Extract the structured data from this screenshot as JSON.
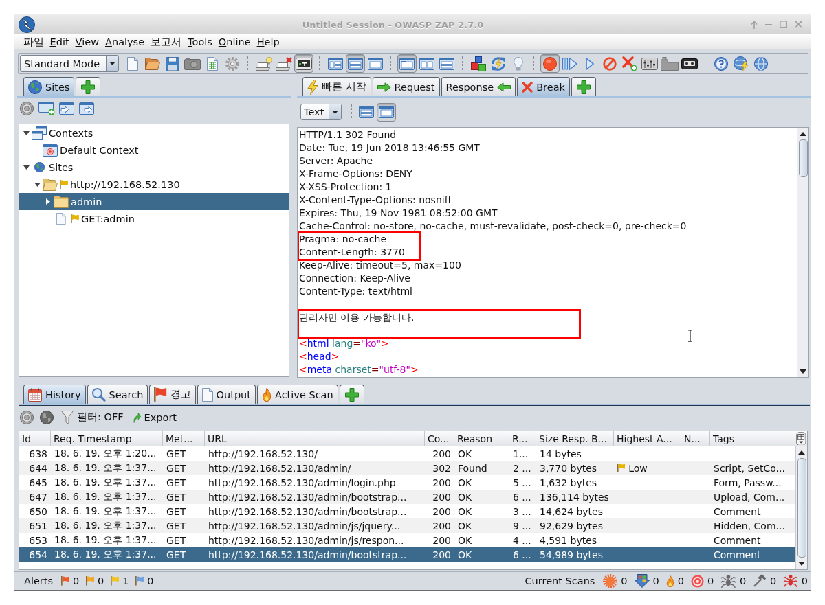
{
  "window": {
    "title": "Untitled Session - OWASP ZAP 2.7.0"
  },
  "menu": [
    {
      "label": "파일",
      "mnemonic": false
    },
    {
      "label": "Edit",
      "mnemonic": true
    },
    {
      "label": "View",
      "mnemonic": true
    },
    {
      "label": "Analyse",
      "mnemonic": true
    },
    {
      "label": "보고서",
      "mnemonic": false
    },
    {
      "label": "Tools",
      "mnemonic": true
    },
    {
      "label": "Online",
      "mnemonic": true
    },
    {
      "label": "Help",
      "mnemonic": true
    }
  ],
  "toolbar": {
    "mode": "Standard Mode",
    "groups": [
      {
        "buttons": [
          {
            "pressed": false
          },
          {
            "pressed": false
          },
          {
            "pressed": false
          },
          {
            "pressed": false
          },
          {
            "pressed": false
          },
          {
            "pressed": false
          }
        ]
      },
      {
        "buttons": [
          {
            "pressed": false
          },
          {
            "pressed": false
          },
          {
            "pressed": true
          }
        ]
      },
      {
        "buttons": [
          {
            "pressed": false
          },
          {
            "pressed": true
          },
          {
            "pressed": false
          }
        ]
      },
      {
        "buttons": [
          {
            "pressed": true
          },
          {
            "pressed": false
          },
          {
            "pressed": false
          }
        ]
      },
      {
        "buttons": [
          {
            "pressed": false
          },
          {
            "pressed": false
          },
          {
            "pressed": false
          }
        ]
      },
      {
        "buttons": [
          {
            "pressed": true
          },
          {
            "pressed": false
          },
          {
            "pressed": false
          },
          {
            "pressed": false
          },
          {
            "pressed": false
          },
          {
            "pressed": false
          },
          {
            "pressed": false
          },
          {
            "pressed": false
          }
        ]
      },
      {
        "buttons": [
          {
            "pressed": false
          },
          {
            "pressed": false
          },
          {
            "pressed": false
          }
        ]
      }
    ]
  },
  "sites_panel": {
    "tabs": [
      {
        "label": "Sites",
        "selected": true
      }
    ],
    "tree": [
      {
        "label": "Contexts",
        "kind": "contexts",
        "expanded": true,
        "selected": false,
        "children": [
          {
            "label": "Default Context",
            "kind": "context",
            "selected": false
          }
        ]
      },
      {
        "label": "Sites",
        "kind": "sites",
        "expanded": true,
        "selected": false,
        "children": [
          {
            "label": "http://192.168.52.130",
            "kind": "site",
            "expanded": true,
            "flagged": true,
            "selected": false,
            "children": [
              {
                "label": "admin",
                "kind": "folder",
                "expanded": false,
                "flagged": false,
                "selected": true
              },
              {
                "label": "GET:admin",
                "kind": "page",
                "flagged": true,
                "selected": false
              }
            ]
          }
        ]
      }
    ]
  },
  "message_panel": {
    "tabs": [
      {
        "label": "빠른 시작",
        "selected": false
      },
      {
        "label": "Request",
        "selected": false
      },
      {
        "label": "Response",
        "selected": false
      },
      {
        "label": "Break",
        "selected": true
      }
    ],
    "format": "Text",
    "view_buttons": [
      {
        "selected": false
      },
      {
        "selected": true
      }
    ],
    "headers": [
      {
        "highlight": false,
        "lines": [
          "HTTP/1.1 302 Found",
          "Date: Tue, 19 Jun 2018 13:46:55 GMT",
          "Server: Apache",
          "X-Frame-Options: DENY",
          "X-XSS-Protection: 1",
          "X-Content-Type-Options: nosniff",
          "Expires: Thu, 19 Nov 1981 08:52:00 GMT",
          "Cache-Control: no-store, no-cache, must-revalidate, post-check=0, pre-check=0"
        ]
      },
      {
        "highlight": true,
        "lines": [
          "Pragma: no-cache",
          "Content-Length: 3770"
        ]
      },
      {
        "highlight": false,
        "lines": [
          "Keep-Alive: timeout=5, max=100",
          "Connection: Keep-Alive",
          "Content-Type: text/html"
        ]
      }
    ],
    "body": [
      {
        "highlight": true,
        "lines": [
          "관리자만 이용 가능합니다."
        ]
      }
    ],
    "markup": [
      [
        {
          "kind": "bracket",
          "text": "<"
        },
        {
          "kind": "tag",
          "text": "html"
        },
        {
          "kind": "attr",
          "text": " lang"
        },
        {
          "kind": "equals",
          "text": "="
        },
        {
          "kind": "value",
          "text": "\"ko\""
        },
        {
          "kind": "bracket",
          "text": ">"
        }
      ],
      [
        {
          "kind": "bracket",
          "text": "<"
        },
        {
          "kind": "tag",
          "text": "head"
        },
        {
          "kind": "bracket",
          "text": ">"
        }
      ],
      [
        {
          "kind": "bracket",
          "text": "<"
        },
        {
          "kind": "tag",
          "text": "meta"
        },
        {
          "kind": "attr",
          "text": " charset"
        },
        {
          "kind": "equals",
          "text": "="
        },
        {
          "kind": "value",
          "text": "\"utf-8\""
        },
        {
          "kind": "bracket",
          "text": ">"
        }
      ]
    ]
  },
  "history_panel": {
    "tabs": [
      {
        "label": "History",
        "selected": true
      },
      {
        "label": "Search",
        "selected": false
      },
      {
        "label": "경고",
        "selected": false
      },
      {
        "label": "Output",
        "selected": false
      },
      {
        "label": "Active Scan",
        "selected": false
      }
    ],
    "filter": "필터: OFF",
    "export": "Export",
    "table": {
      "columns": [
        "Id",
        "Req. Timestamp",
        "Met...",
        "URL",
        "Co...",
        "Reason",
        "R...",
        "Size Resp. B...",
        "Highest A...",
        "N...",
        "Tags"
      ],
      "rows": [
        {
          "selected": false,
          "id": "638",
          "req_timestamp": "18. 6. 19. 오후 1:20...",
          "met": "GET",
          "url": "http://192.168.52.130/",
          "co": "200",
          "reason": "OK",
          "r": "1...",
          "size_resp_b": "14 bytes"
        },
        {
          "selected": false,
          "id": "644",
          "req_timestamp": "18. 6. 19. 오후 1:37...",
          "met": "GET",
          "url": "http://192.168.52.130/admin/",
          "co": "302",
          "reason": "Found",
          "r": "2 ...",
          "size_resp_b": "3,770 bytes",
          "highest_a": "Low",
          "tags": "Script, SetCo..."
        },
        {
          "selected": false,
          "id": "645",
          "req_timestamp": "18. 6. 19. 오후 1:37...",
          "met": "GET",
          "url": "http://192.168.52.130/admin/login.php",
          "co": "200",
          "reason": "OK",
          "r": "5 ...",
          "size_resp_b": "1,632 bytes",
          "tags": "Form, Passw..."
        },
        {
          "selected": false,
          "id": "647",
          "req_timestamp": "18. 6. 19. 오후 1:37...",
          "met": "GET",
          "url": "http://192.168.52.130/admin/bootstrap...",
          "co": "200",
          "reason": "OK",
          "r": "6 ...",
          "size_resp_b": "136,114 bytes",
          "tags": "Upload, Com..."
        },
        {
          "selected": false,
          "id": "650",
          "req_timestamp": "18. 6. 19. 오후 1:37...",
          "met": "GET",
          "url": "http://192.168.52.130/admin/bootstrap...",
          "co": "200",
          "reason": "OK",
          "r": "3 ...",
          "size_resp_b": "14,624 bytes",
          "tags": "Comment"
        },
        {
          "selected": false,
          "id": "651",
          "req_timestamp": "18. 6. 19. 오후 1:37...",
          "met": "GET",
          "url": "http://192.168.52.130/admin/js/jquery...",
          "co": "200",
          "reason": "OK",
          "r": "9 ...",
          "size_resp_b": "92,629 bytes",
          "tags": "Hidden, Com..."
        },
        {
          "selected": false,
          "id": "653",
          "req_timestamp": "18. 6. 19. 오후 1:37...",
          "met": "GET",
          "url": "http://192.168.52.130/admin/js/respon...",
          "co": "200",
          "reason": "OK",
          "r": "4 ...",
          "size_resp_b": "4,591 bytes",
          "tags": "Comment"
        },
        {
          "selected": true,
          "id": "654",
          "req_timestamp": "18. 6. 19. 오후 1:37...",
          "met": "GET",
          "url": "http://192.168.52.130/admin/bootstrap...",
          "co": "200",
          "reason": "OK",
          "r": "6 ...",
          "size_resp_b": "54,989 bytes",
          "tags": "Comment"
        }
      ]
    }
  },
  "status_bar": {
    "alerts_label": "Alerts",
    "alerts": [
      {
        "color": "#f05a28",
        "count": "0"
      },
      {
        "color": "#f5a623",
        "count": "0"
      },
      {
        "color": "#f0c419",
        "count": "1"
      },
      {
        "color": "#6fa0e0",
        "count": "0"
      }
    ],
    "scans_label": "Current Scans",
    "scans": [
      {
        "count": "0"
      },
      {
        "count": "0"
      },
      {
        "count": "0"
      },
      {
        "count": "0"
      },
      {
        "count": "0"
      },
      {
        "count": "0"
      },
      {
        "count": "0"
      }
    ]
  }
}
